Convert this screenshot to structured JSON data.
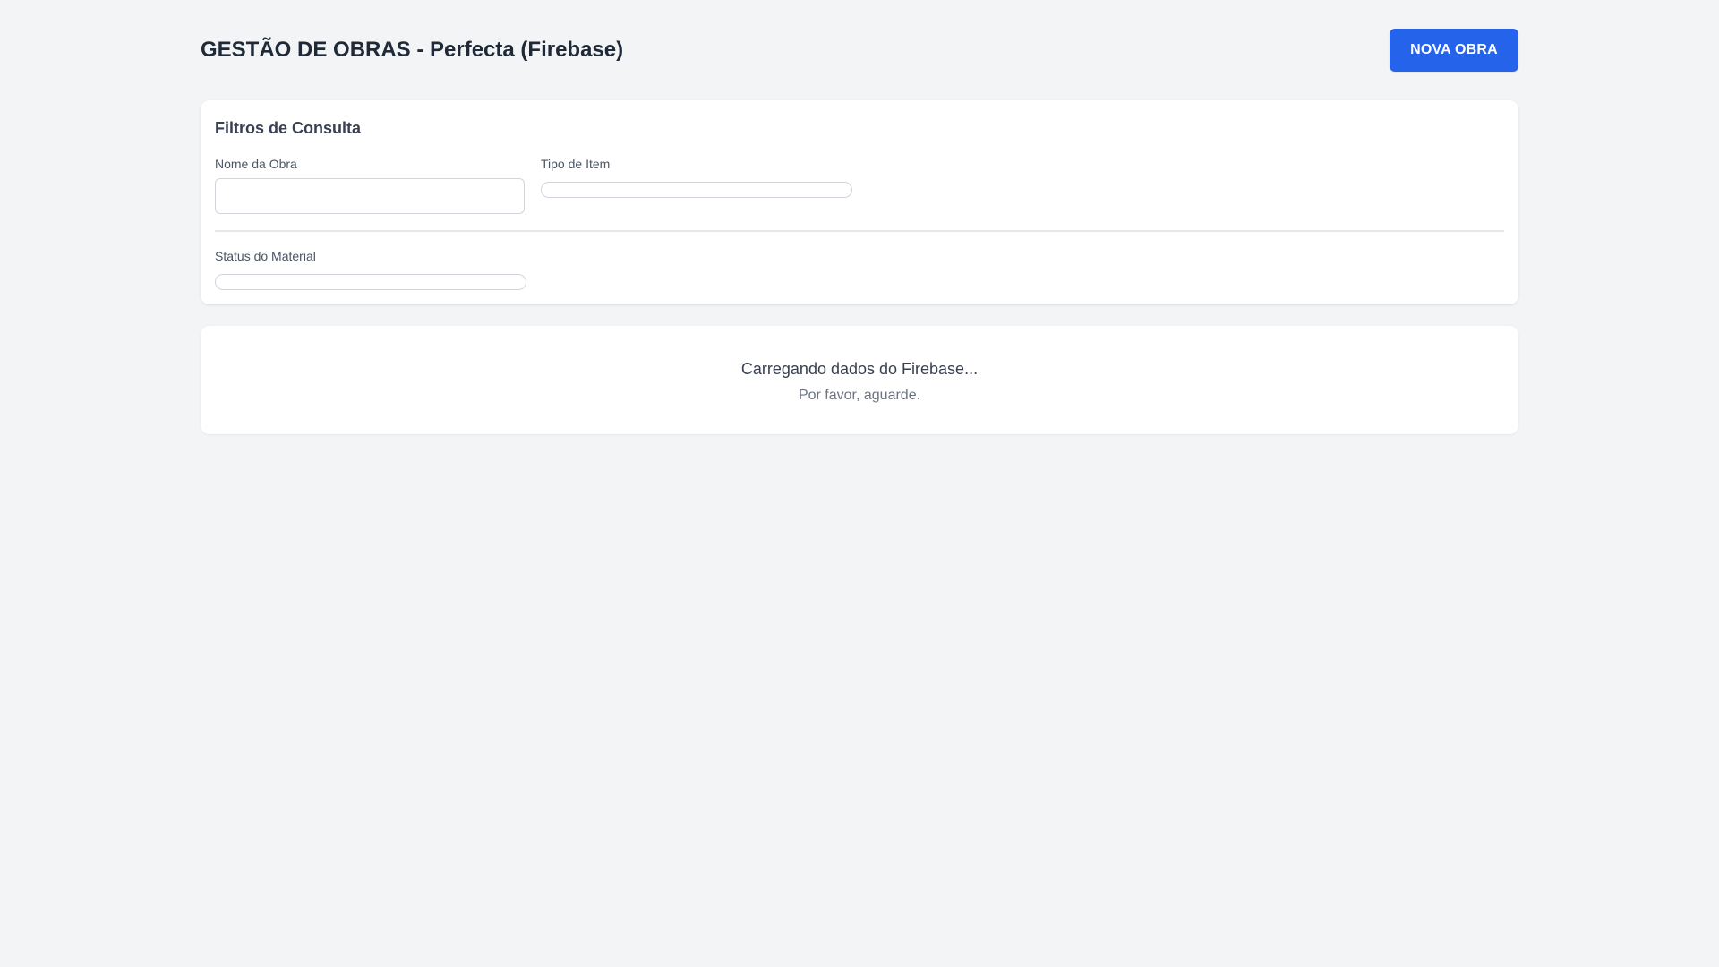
{
  "header": {
    "title": "GESTÃO DE OBRAS - Perfecta (Firebase)",
    "new_button_label": "NOVA OBRA"
  },
  "filters": {
    "title": "Filtros de Consulta",
    "obra_name": {
      "label": "Nome da Obra",
      "value": ""
    },
    "item_type": {
      "label": "Tipo de Item"
    },
    "material_status": {
      "label": "Status do Material"
    }
  },
  "loading": {
    "title": "Carregando dados do Firebase...",
    "subtitle": "Por favor, aguarde."
  },
  "colors": {
    "background": "#f3f4f6",
    "primary": "#2563eb",
    "card": "#ffffff"
  }
}
